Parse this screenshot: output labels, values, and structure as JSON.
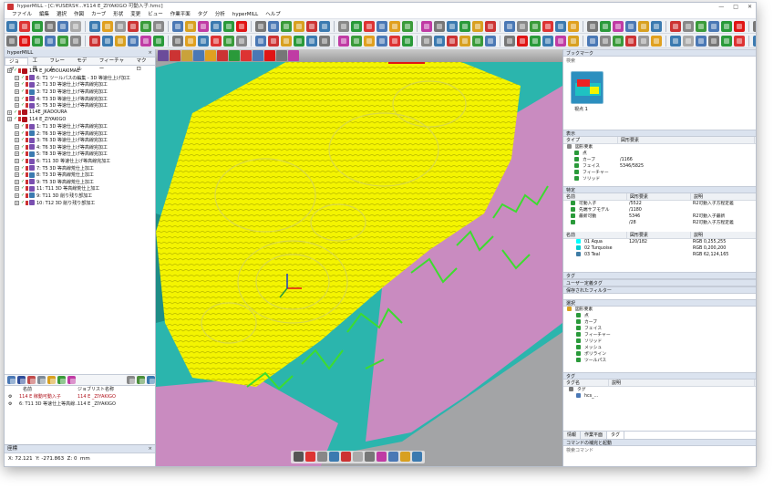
{
  "window": {
    "title": "hyperMILL - [C:¥USERS¥...¥114 E_ZIYAKIGO 可動入子.hmc]",
    "min": "—",
    "max": "□",
    "close": "✕"
  },
  "menu": [
    "ファイル",
    "編集",
    "選択",
    "作図",
    "カーブ",
    "形状",
    "変更",
    "ビュー",
    "作業平面",
    "タグ",
    "分析",
    "hyperMILL",
    "ヘルプ"
  ],
  "left_panel": {
    "title": "hyperMILL",
    "close": "×",
    "tabs": [
      "ジョブ",
      "工具",
      "フレーム",
      "モデル",
      "フィーチャー",
      "マクロ"
    ],
    "tree": [
      {
        "indent": 0,
        "label": "114 E_JKADOUAKIMAE",
        "color": "#b0121b"
      },
      {
        "indent": 1,
        "label": "6: T1 ツールパスの編集 - 3D 等速仕上げ加工",
        "color": "#b0121b"
      },
      {
        "indent": 1,
        "label": "2: T1 3D 等速仕上げ等高線完加工",
        "color": "#b0121b"
      },
      {
        "indent": 1,
        "label": "3: T2 3D 等速仕上げ等高線完加工",
        "color": "#b0121b"
      },
      {
        "indent": 1,
        "label": "4: T3 3D 等速仕上げ等高線完加工",
        "color": "#b0121b"
      },
      {
        "indent": 1,
        "label": "5: T5 3D 等速仕上げ等高線完加工",
        "color": "#b0121b"
      },
      {
        "indent": 0,
        "label": "114E_JKADOURA",
        "color": "#b0121b"
      },
      {
        "indent": 0,
        "label": "114 E_ZIYAKIGO",
        "color": "#b0121b"
      },
      {
        "indent": 1,
        "label": "1: T1 3D 等速仕上げ等高線完加工",
        "color": "#b0121b"
      },
      {
        "indent": 1,
        "label": "2: T6 3D 等速仕上げ等高線完加工",
        "color": "#b0121b"
      },
      {
        "indent": 1,
        "label": "3: T6 3D 等速仕上げ等高線完加工",
        "color": "#b0121b"
      },
      {
        "indent": 1,
        "label": "4: T6 3D 等速仕上げ等高線完加工",
        "color": "#b0121b"
      },
      {
        "indent": 1,
        "label": "5: T8 3D 等速仕上げ等高線完加工",
        "color": "#b0121b"
      },
      {
        "indent": 1,
        "label": "6: T11 3D 等速仕上げ等高線完加工",
        "color": "#b0121b"
      },
      {
        "indent": 1,
        "label": "7: T5 3D 等高線荒仕上加工",
        "color": "#b0121b"
      },
      {
        "indent": 1,
        "label": "8: T3 3D 等高線荒仕上加工",
        "color": "#b0121b"
      },
      {
        "indent": 1,
        "label": "9: T5 3D 等高線荒仕上加工",
        "color": "#b0121b"
      },
      {
        "indent": 1,
        "label": "11: T11 3D 等高線荒仕上加工",
        "color": "#b0121b"
      },
      {
        "indent": 1,
        "label": "9: T11 3D 削り残り部加工",
        "color": "#b0121b"
      },
      {
        "indent": 1,
        "label": "10: T12 3D 削り残り部加工",
        "color": "#b0121b"
      }
    ],
    "list_headers": [
      "名前",
      "ジョブリスト名称"
    ],
    "list_rows": [
      {
        "name": "114 E 稼動可動入子",
        "job": "114 E _ZIYAKIGO"
      },
      {
        "name": "6: T11 3D 等速仕上等高線...",
        "job": "114 E _ZIYAKIGO"
      }
    ]
  },
  "coords": {
    "title": "座標",
    "close": "×",
    "x_label": "X:",
    "x": "72.121",
    "y_label": "Y:",
    "y": "-271.863",
    "z_label": "Z:",
    "z": "0",
    "unit": "mm"
  },
  "right_panel": {
    "bookmark_title": "ブックマーク",
    "bookmark_sub": "検索",
    "bookmark_item": "視点 1",
    "display_title": "表示",
    "display_cols": [
      "タイプ",
      "図形要素"
    ],
    "display_rows": [
      {
        "icon": "#888",
        "a": "図形要素",
        "b": ""
      },
      {
        "icon": "#2a9a3a",
        "a": "点",
        "b": ""
      },
      {
        "icon": "#2a9a3a",
        "a": "カーブ",
        "b": "/1166"
      },
      {
        "icon": "#2a9a3a",
        "a": "フェイス",
        "b": "5346/5825"
      },
      {
        "icon": "#2a9a3a",
        "a": "フィーチャー",
        "b": ""
      },
      {
        "icon": "#2a9a3a",
        "a": "ソリッド",
        "b": ""
      }
    ],
    "table_title": "特定",
    "table_cols": [
      "名前",
      "図形要素",
      "説明"
    ],
    "table_rows": [
      {
        "a": "可動入子",
        "b": "/5522",
        "c": "R2可動入子方程定義"
      },
      {
        "a": "先端サブモデル",
        "b": "/1180",
        "c": ""
      },
      {
        "a": "最新可動",
        "b": "5346",
        "c": "R2可動入子最新"
      },
      {
        "a": "",
        "b": "/28",
        "c": "R2可動入子方程定義"
      }
    ],
    "color_cols": [
      "名前",
      "図形要素",
      "説明"
    ],
    "color_rows": [
      {
        "icon": "#00ffff",
        "a": "01 Aqua",
        "b": "120/182",
        "c": "RGB 0,255,255"
      },
      {
        "icon": "#00ced1",
        "a": "02 Turquoise",
        "b": "",
        "c": "RGB 0,200,200"
      },
      {
        "icon": "#3e7ca5",
        "a": "03 Teal",
        "b": "",
        "c": "RGB 62,124,165"
      }
    ],
    "tag_header": "タグ",
    "user_tag": "ユーザー定義タグ",
    "saved_filter": "保存されたフィルター",
    "select_title": "選択",
    "select_rows": [
      "図形要素",
      "点",
      "カーブ",
      "フェイス",
      "フィーチャー",
      "ソリッド",
      "メッシュ",
      "ポリライン",
      "ツールパス"
    ],
    "tag2_title": "タグ",
    "tag2_cols": [
      "タグ名",
      "説明"
    ],
    "tag2_rows": [
      "タグ",
      "hcs_..."
    ],
    "bottom_tabs": [
      "情報",
      "作業平面",
      "タグ"
    ],
    "cmd_title": "コマンドの補完と起動",
    "cmd_placeholder": "検索コマンド"
  },
  "colors": {
    "model_cyan": "#2bb5ad",
    "model_pink": "#c98bc0",
    "toolpath_yellow": "#f4f400",
    "toolpath_green": "#3ddc2f",
    "red_feature": "#e01515"
  }
}
